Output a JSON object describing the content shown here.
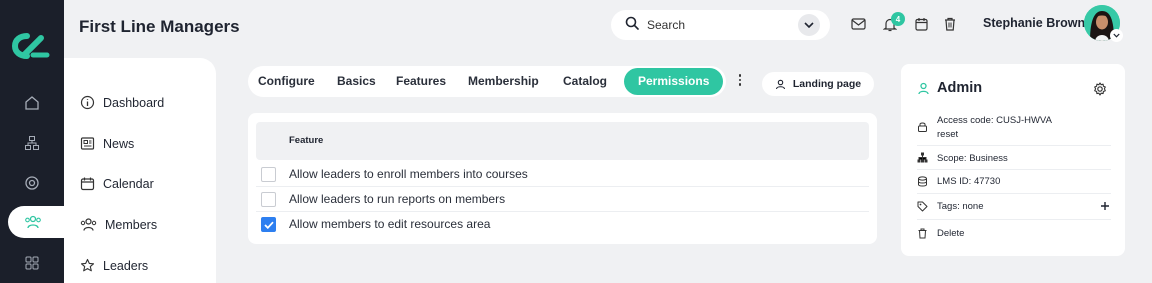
{
  "header": {
    "title": "First Line Managers",
    "search_placeholder": "Search",
    "notification_count": "4",
    "user_name": "Stephanie Brown"
  },
  "sidebar": {
    "items": [
      {
        "label": "Dashboard",
        "icon": "info-icon"
      },
      {
        "label": "News",
        "icon": "newspaper-icon"
      },
      {
        "label": "Calendar",
        "icon": "calendar-icon"
      },
      {
        "label": "Members",
        "icon": "users-icon"
      },
      {
        "label": "Leaders",
        "icon": "star-icon"
      }
    ]
  },
  "rail": {
    "items": [
      "home-icon",
      "hierarchy-icon",
      "target-icon",
      "users-icon",
      "grid-icon"
    ],
    "active": "users-icon"
  },
  "tabs": {
    "items": [
      "Configure",
      "Basics",
      "Features",
      "Membership",
      "Catalog",
      "Permissions"
    ],
    "active": "Permissions"
  },
  "landing_page_label": "Landing page",
  "features": {
    "header": "Feature",
    "rows": [
      {
        "label": "Allow leaders to enroll members into courses",
        "checked": false
      },
      {
        "label": "Allow leaders to run reports on members",
        "checked": false
      },
      {
        "label": "Allow members to edit resources area",
        "checked": true
      }
    ]
  },
  "admin": {
    "title": "Admin",
    "access_code": "Access code: CUSJ-HWVA",
    "reset_label": "reset",
    "scope": "Scope: Business",
    "lms_id": "LMS ID: 47730",
    "tags": "Tags: none",
    "delete_label": "Delete"
  },
  "colors": {
    "accent": "#2fc6a2",
    "rail_bg": "#1b1f2a",
    "link": "#2d7ff0",
    "page_bg": "#f0f1f3"
  }
}
